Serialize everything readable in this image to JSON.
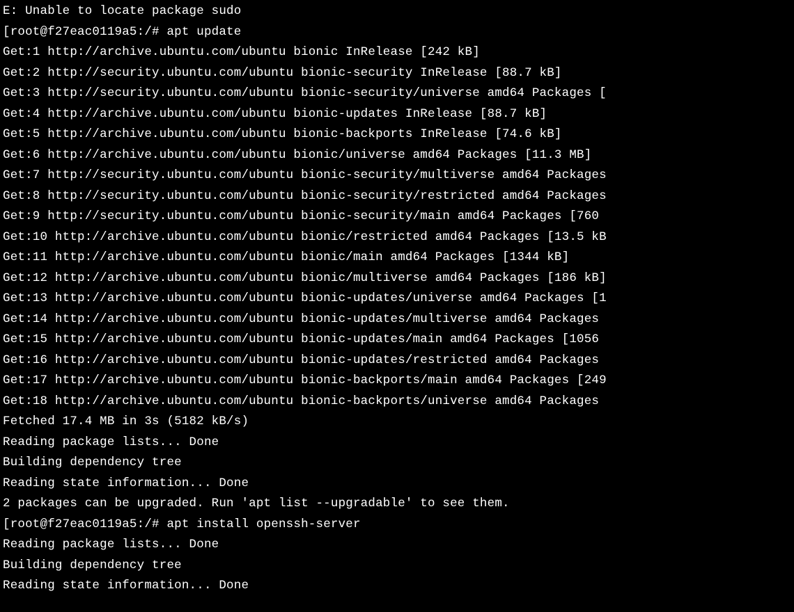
{
  "lines": [
    {
      "text": "E: Unable to locate package sudo"
    },
    {
      "prompt": "[root@f27eac0119a5:/# ",
      "command": "apt update"
    },
    {
      "text": "Get:1 http://archive.ubuntu.com/ubuntu bionic InRelease [242 kB]"
    },
    {
      "text": "Get:2 http://security.ubuntu.com/ubuntu bionic-security InRelease [88.7 kB]"
    },
    {
      "text": "Get:3 http://security.ubuntu.com/ubuntu bionic-security/universe amd64 Packages ["
    },
    {
      "text": "Get:4 http://archive.ubuntu.com/ubuntu bionic-updates InRelease [88.7 kB]"
    },
    {
      "text": "Get:5 http://archive.ubuntu.com/ubuntu bionic-backports InRelease [74.6 kB]"
    },
    {
      "text": "Get:6 http://archive.ubuntu.com/ubuntu bionic/universe amd64 Packages [11.3 MB]"
    },
    {
      "text": "Get:7 http://security.ubuntu.com/ubuntu bionic-security/multiverse amd64 Packages"
    },
    {
      "text": "Get:8 http://security.ubuntu.com/ubuntu bionic-security/restricted amd64 Packages"
    },
    {
      "text": "Get:9 http://security.ubuntu.com/ubuntu bionic-security/main amd64 Packages [760 "
    },
    {
      "text": "Get:10 http://archive.ubuntu.com/ubuntu bionic/restricted amd64 Packages [13.5 kB"
    },
    {
      "text": "Get:11 http://archive.ubuntu.com/ubuntu bionic/main amd64 Packages [1344 kB]"
    },
    {
      "text": "Get:12 http://archive.ubuntu.com/ubuntu bionic/multiverse amd64 Packages [186 kB]"
    },
    {
      "text": "Get:13 http://archive.ubuntu.com/ubuntu bionic-updates/universe amd64 Packages [1"
    },
    {
      "text": "Get:14 http://archive.ubuntu.com/ubuntu bionic-updates/multiverse amd64 Packages "
    },
    {
      "text": "Get:15 http://archive.ubuntu.com/ubuntu bionic-updates/main amd64 Packages [1056 "
    },
    {
      "text": "Get:16 http://archive.ubuntu.com/ubuntu bionic-updates/restricted amd64 Packages "
    },
    {
      "text": "Get:17 http://archive.ubuntu.com/ubuntu bionic-backports/main amd64 Packages [249"
    },
    {
      "text": "Get:18 http://archive.ubuntu.com/ubuntu bionic-backports/universe amd64 Packages "
    },
    {
      "text": "Fetched 17.4 MB in 3s (5182 kB/s)"
    },
    {
      "text": "Reading package lists... Done"
    },
    {
      "text": "Building dependency tree"
    },
    {
      "text": "Reading state information... Done"
    },
    {
      "text": "2 packages can be upgraded. Run 'apt list --upgradable' to see them."
    },
    {
      "prompt": "[root@f27eac0119a5:/# ",
      "command": "apt install openssh-server"
    },
    {
      "text": "Reading package lists... Done"
    },
    {
      "text": "Building dependency tree"
    },
    {
      "text": "Reading state information... Done"
    }
  ]
}
